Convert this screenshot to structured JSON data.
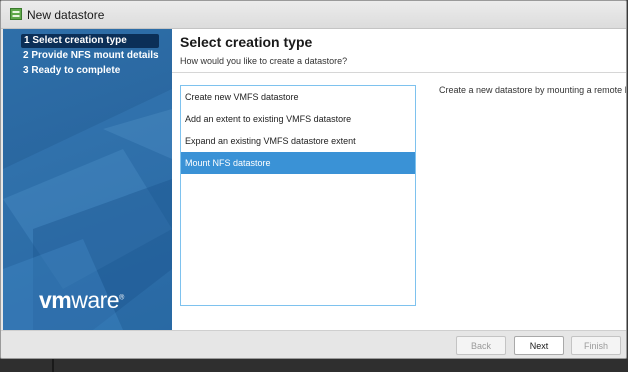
{
  "window": {
    "title": "New datastore"
  },
  "sidebar": {
    "steps": [
      {
        "label": "1 Select creation type",
        "active": true
      },
      {
        "label": "2 Provide NFS mount details",
        "active": false
      },
      {
        "label": "3 Ready to complete",
        "active": false
      }
    ],
    "logo": {
      "bold": "vm",
      "rest": "ware",
      "mark": "®"
    }
  },
  "main": {
    "title": "Select creation type",
    "subtitle": "How would you like to create a datastore?",
    "options": [
      {
        "label": "Create new VMFS datastore",
        "selected": false
      },
      {
        "label": "Add an extent to existing VMFS datastore",
        "selected": false
      },
      {
        "label": "Expand an existing VMFS datastore extent",
        "selected": false
      },
      {
        "label": "Mount NFS datastore",
        "selected": true
      }
    ],
    "description": "Create a new datastore by mounting a remote N"
  },
  "footer": {
    "back_label": "Back",
    "next_label": "Next",
    "finish_label": "Finish"
  },
  "colors": {
    "sidebar_bg": "#2a67a0",
    "active_step_bg": "#0b2f57",
    "selected_option_bg": "#3a92d6",
    "list_border": "#7ec2ee"
  }
}
